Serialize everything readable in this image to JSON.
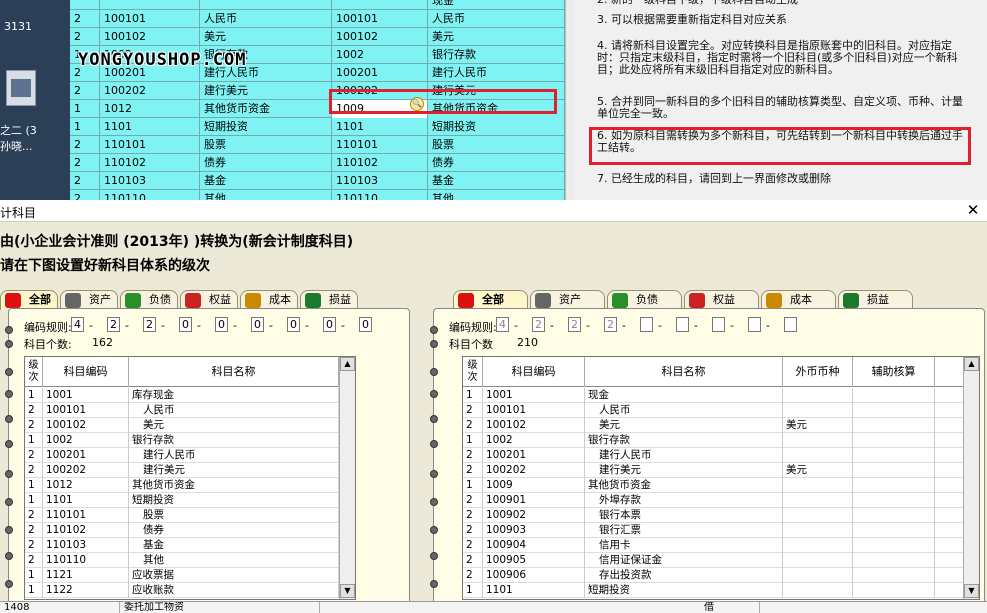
{
  "desktop": {
    "text1": "3131",
    "text2": "之二 (3",
    "text3": "孙晓..."
  },
  "watermark": "YONGYOUSHOP.COM",
  "background_grid": {
    "rows": [
      [
        "",
        "",
        "",
        "",
        "现金"
      ],
      [
        "2",
        "100101",
        "人民币",
        "100101",
        "人民币"
      ],
      [
        "2",
        "100102",
        "美元",
        "100102",
        "美元"
      ],
      [
        "1",
        "1002",
        "银行存款",
        "1002",
        "银行存款"
      ],
      [
        "2",
        "100201",
        "建行人民币",
        "100201",
        "建行人民币"
      ],
      [
        "2",
        "100202",
        "建行美元",
        "100202",
        "建行美元"
      ],
      [
        "1",
        "1012",
        "其他货币资金",
        "1009",
        "其他货币资金"
      ],
      [
        "1",
        "1101",
        "短期投资",
        "1101",
        "短期投资"
      ],
      [
        "2",
        "110101",
        "股票",
        "110101",
        "股票"
      ],
      [
        "2",
        "110102",
        "债券",
        "110102",
        "债券"
      ],
      [
        "2",
        "110103",
        "基金",
        "110103",
        "基金"
      ],
      [
        "2",
        "110110",
        "其他",
        "110110",
        "其他"
      ]
    ]
  },
  "notes": [
    "2. 新的一级科目下级，下级科目自动生成",
    "3. 可以根据需要重新指定科目对应关系",
    "4. 请将新科目设置完全。对应转换科目是指原账套中的旧科目。对应指定时：只指定末级科目，指定时需将一个旧科目(或多个旧科目)对应一个新科目；此处应将所有末级旧科目指定对应的新科目。",
    "5. 合并到同一新科目的多个旧科目的辅助核算类型、自定义项、币种、计量单位完全一致。",
    "6. 如为原科目需转换为多个新科目，可先结转到一个新科目中转换后通过手工结转。",
    "7. 已经生成的科目，请回到上一界面修改或删除"
  ],
  "dialog": {
    "title": "计科目",
    "close": "✕",
    "heading1": "由(小企业会计准则 (2013年) )转换为(新会计制度科目)",
    "heading2": "请在下图设置好新科目体系的级次"
  },
  "tabs": [
    "全部",
    "资产",
    "负债",
    "权益",
    "成本",
    "损益"
  ],
  "left_panel": {
    "code_rule_label": "编码规则:",
    "code_rule": [
      "4",
      "2",
      "2",
      "0",
      "0",
      "0",
      "0",
      "0",
      "0"
    ],
    "count_label": "科目个数:",
    "count": "162",
    "headers": [
      "级次",
      "科目编码",
      "科目名称"
    ],
    "rows": [
      [
        "1",
        "1001",
        "库存现金"
      ],
      [
        "2",
        "100101",
        "人民币"
      ],
      [
        "2",
        "100102",
        "美元"
      ],
      [
        "1",
        "1002",
        "银行存款"
      ],
      [
        "2",
        "100201",
        "建行人民币"
      ],
      [
        "2",
        "100202",
        "建行美元"
      ],
      [
        "1",
        "1012",
        "其他货币资金"
      ],
      [
        "1",
        "1101",
        "短期投资"
      ],
      [
        "2",
        "110101",
        "股票"
      ],
      [
        "2",
        "110102",
        "债券"
      ],
      [
        "2",
        "110103",
        "基金"
      ],
      [
        "2",
        "110110",
        "其他"
      ],
      [
        "1",
        "1121",
        "应收票据"
      ],
      [
        "1",
        "1122",
        "应收账款"
      ]
    ]
  },
  "right_panel": {
    "code_rule_label": "编码规则:",
    "code_rule": [
      "4",
      "2",
      "2",
      "2",
      "",
      "",
      "",
      "",
      ""
    ],
    "count_label": "科目个数",
    "count": "210",
    "headers": [
      "级次",
      "科目编码",
      "科目名称",
      "外币币种",
      "辅助核算"
    ],
    "rows": [
      [
        "1",
        "1001",
        "现金",
        "",
        ""
      ],
      [
        "2",
        "100101",
        "人民币",
        "",
        ""
      ],
      [
        "2",
        "100102",
        "美元",
        "美元",
        ""
      ],
      [
        "1",
        "1002",
        "银行存款",
        "",
        ""
      ],
      [
        "2",
        "100201",
        "建行人民币",
        "",
        ""
      ],
      [
        "2",
        "100202",
        "建行美元",
        "美元",
        ""
      ],
      [
        "1",
        "1009",
        "其他货币资金",
        "",
        ""
      ],
      [
        "2",
        "100901",
        "外埠存款",
        "",
        ""
      ],
      [
        "2",
        "100902",
        "银行本票",
        "",
        ""
      ],
      [
        "2",
        "100903",
        "银行汇票",
        "",
        ""
      ],
      [
        "2",
        "100904",
        "信用卡",
        "",
        ""
      ],
      [
        "2",
        "100905",
        "信用证保证金",
        "",
        ""
      ],
      [
        "2",
        "100906",
        "存出投资款",
        "",
        ""
      ],
      [
        "1",
        "1101",
        "短期投资",
        "",
        ""
      ]
    ]
  },
  "bottom_strip": [
    "1408",
    "委托加工物资",
    "借"
  ]
}
